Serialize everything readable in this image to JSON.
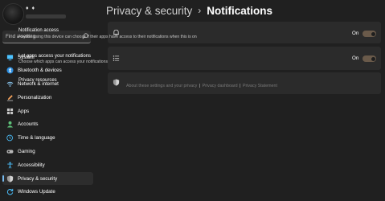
{
  "profile": {
    "name": "♦ ♦"
  },
  "search": {
    "placeholder": "Find a setting"
  },
  "nav": [
    {
      "label": "System",
      "icon": "monitor-icon"
    },
    {
      "label": "Bluetooth & devices",
      "icon": "bluetooth-icon"
    },
    {
      "label": "Network & internet",
      "icon": "wifi-icon"
    },
    {
      "label": "Personalization",
      "icon": "pen-icon"
    },
    {
      "label": "Apps",
      "icon": "apps-icon"
    },
    {
      "label": "Accounts",
      "icon": "person-icon"
    },
    {
      "label": "Time & language",
      "icon": "globe-clock-icon"
    },
    {
      "label": "Gaming",
      "icon": "gamepad-icon"
    },
    {
      "label": "Accessibility",
      "icon": "accessibility-icon"
    },
    {
      "label": "Privacy & security",
      "icon": "shield-icon",
      "active": true
    },
    {
      "label": "Windows Update",
      "icon": "update-icon"
    }
  ],
  "header": {
    "parent": "Privacy & security",
    "separator": "›",
    "current": "Notifications"
  },
  "settings": [
    {
      "title": "Notification access",
      "description": "Anyone using this device can choose if their apps have access to their notifications when this is on",
      "state": "On",
      "icon": "bell-icon"
    },
    {
      "title": "Let apps access your notifications",
      "description": "Choose which apps can access your notifications",
      "state": "On",
      "icon": "list-icon"
    }
  ],
  "privacy_resources": {
    "title": "Privacy resources",
    "links": [
      "About these settings and your privacy",
      "Privacy dashboard",
      "Privacy Statement"
    ],
    "separator": "|",
    "icon": "shield-icon"
  },
  "colors": {
    "accent": "#76b9ed",
    "toggle_on": "#6a5a4a",
    "background": "#202020",
    "card": "#2b2b2b"
  }
}
